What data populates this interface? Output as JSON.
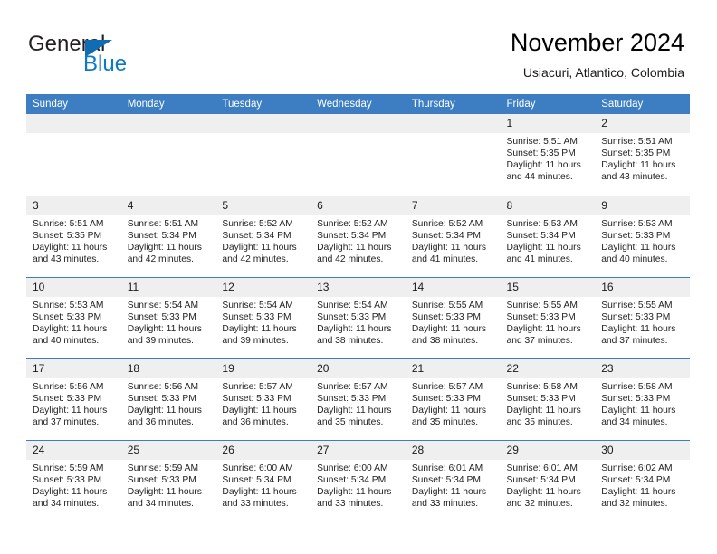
{
  "brand": {
    "name_part1": "General",
    "name_part2": "Blue",
    "icon": "triangle-logo-icon"
  },
  "header": {
    "title": "November 2024",
    "subtitle": "Usiacuri, Atlantico, Colombia"
  },
  "colors": {
    "header_blue": "#3c7ec1",
    "brand_blue": "#0f7ac4",
    "daynum_band": "#efefef",
    "text": "#222222"
  },
  "weekday_headers": [
    "Sunday",
    "Monday",
    "Tuesday",
    "Wednesday",
    "Thursday",
    "Friday",
    "Saturday"
  ],
  "weeks": [
    [
      {
        "day": "",
        "blank": true,
        "sunrise": "",
        "sunset": "",
        "daylight_line1": "",
        "daylight_line2": ""
      },
      {
        "day": "",
        "blank": true,
        "sunrise": "",
        "sunset": "",
        "daylight_line1": "",
        "daylight_line2": ""
      },
      {
        "day": "",
        "blank": true,
        "sunrise": "",
        "sunset": "",
        "daylight_line1": "",
        "daylight_line2": ""
      },
      {
        "day": "",
        "blank": true,
        "sunrise": "",
        "sunset": "",
        "daylight_line1": "",
        "daylight_line2": ""
      },
      {
        "day": "",
        "blank": true,
        "sunrise": "",
        "sunset": "",
        "daylight_line1": "",
        "daylight_line2": ""
      },
      {
        "day": "1",
        "sunrise": "Sunrise: 5:51 AM",
        "sunset": "Sunset: 5:35 PM",
        "daylight_line1": "Daylight: 11 hours",
        "daylight_line2": "and 44 minutes."
      },
      {
        "day": "2",
        "sunrise": "Sunrise: 5:51 AM",
        "sunset": "Sunset: 5:35 PM",
        "daylight_line1": "Daylight: 11 hours",
        "daylight_line2": "and 43 minutes."
      }
    ],
    [
      {
        "day": "3",
        "sunrise": "Sunrise: 5:51 AM",
        "sunset": "Sunset: 5:35 PM",
        "daylight_line1": "Daylight: 11 hours",
        "daylight_line2": "and 43 minutes."
      },
      {
        "day": "4",
        "sunrise": "Sunrise: 5:51 AM",
        "sunset": "Sunset: 5:34 PM",
        "daylight_line1": "Daylight: 11 hours",
        "daylight_line2": "and 42 minutes."
      },
      {
        "day": "5",
        "sunrise": "Sunrise: 5:52 AM",
        "sunset": "Sunset: 5:34 PM",
        "daylight_line1": "Daylight: 11 hours",
        "daylight_line2": "and 42 minutes."
      },
      {
        "day": "6",
        "sunrise": "Sunrise: 5:52 AM",
        "sunset": "Sunset: 5:34 PM",
        "daylight_line1": "Daylight: 11 hours",
        "daylight_line2": "and 42 minutes."
      },
      {
        "day": "7",
        "sunrise": "Sunrise: 5:52 AM",
        "sunset": "Sunset: 5:34 PM",
        "daylight_line1": "Daylight: 11 hours",
        "daylight_line2": "and 41 minutes."
      },
      {
        "day": "8",
        "sunrise": "Sunrise: 5:53 AM",
        "sunset": "Sunset: 5:34 PM",
        "daylight_line1": "Daylight: 11 hours",
        "daylight_line2": "and 41 minutes."
      },
      {
        "day": "9",
        "sunrise": "Sunrise: 5:53 AM",
        "sunset": "Sunset: 5:33 PM",
        "daylight_line1": "Daylight: 11 hours",
        "daylight_line2": "and 40 minutes."
      }
    ],
    [
      {
        "day": "10",
        "sunrise": "Sunrise: 5:53 AM",
        "sunset": "Sunset: 5:33 PM",
        "daylight_line1": "Daylight: 11 hours",
        "daylight_line2": "and 40 minutes."
      },
      {
        "day": "11",
        "sunrise": "Sunrise: 5:54 AM",
        "sunset": "Sunset: 5:33 PM",
        "daylight_line1": "Daylight: 11 hours",
        "daylight_line2": "and 39 minutes."
      },
      {
        "day": "12",
        "sunrise": "Sunrise: 5:54 AM",
        "sunset": "Sunset: 5:33 PM",
        "daylight_line1": "Daylight: 11 hours",
        "daylight_line2": "and 39 minutes."
      },
      {
        "day": "13",
        "sunrise": "Sunrise: 5:54 AM",
        "sunset": "Sunset: 5:33 PM",
        "daylight_line1": "Daylight: 11 hours",
        "daylight_line2": "and 38 minutes."
      },
      {
        "day": "14",
        "sunrise": "Sunrise: 5:55 AM",
        "sunset": "Sunset: 5:33 PM",
        "daylight_line1": "Daylight: 11 hours",
        "daylight_line2": "and 38 minutes."
      },
      {
        "day": "15",
        "sunrise": "Sunrise: 5:55 AM",
        "sunset": "Sunset: 5:33 PM",
        "daylight_line1": "Daylight: 11 hours",
        "daylight_line2": "and 37 minutes."
      },
      {
        "day": "16",
        "sunrise": "Sunrise: 5:55 AM",
        "sunset": "Sunset: 5:33 PM",
        "daylight_line1": "Daylight: 11 hours",
        "daylight_line2": "and 37 minutes."
      }
    ],
    [
      {
        "day": "17",
        "sunrise": "Sunrise: 5:56 AM",
        "sunset": "Sunset: 5:33 PM",
        "daylight_line1": "Daylight: 11 hours",
        "daylight_line2": "and 37 minutes."
      },
      {
        "day": "18",
        "sunrise": "Sunrise: 5:56 AM",
        "sunset": "Sunset: 5:33 PM",
        "daylight_line1": "Daylight: 11 hours",
        "daylight_line2": "and 36 minutes."
      },
      {
        "day": "19",
        "sunrise": "Sunrise: 5:57 AM",
        "sunset": "Sunset: 5:33 PM",
        "daylight_line1": "Daylight: 11 hours",
        "daylight_line2": "and 36 minutes."
      },
      {
        "day": "20",
        "sunrise": "Sunrise: 5:57 AM",
        "sunset": "Sunset: 5:33 PM",
        "daylight_line1": "Daylight: 11 hours",
        "daylight_line2": "and 35 minutes."
      },
      {
        "day": "21",
        "sunrise": "Sunrise: 5:57 AM",
        "sunset": "Sunset: 5:33 PM",
        "daylight_line1": "Daylight: 11 hours",
        "daylight_line2": "and 35 minutes."
      },
      {
        "day": "22",
        "sunrise": "Sunrise: 5:58 AM",
        "sunset": "Sunset: 5:33 PM",
        "daylight_line1": "Daylight: 11 hours",
        "daylight_line2": "and 35 minutes."
      },
      {
        "day": "23",
        "sunrise": "Sunrise: 5:58 AM",
        "sunset": "Sunset: 5:33 PM",
        "daylight_line1": "Daylight: 11 hours",
        "daylight_line2": "and 34 minutes."
      }
    ],
    [
      {
        "day": "24",
        "sunrise": "Sunrise: 5:59 AM",
        "sunset": "Sunset: 5:33 PM",
        "daylight_line1": "Daylight: 11 hours",
        "daylight_line2": "and 34 minutes."
      },
      {
        "day": "25",
        "sunrise": "Sunrise: 5:59 AM",
        "sunset": "Sunset: 5:33 PM",
        "daylight_line1": "Daylight: 11 hours",
        "daylight_line2": "and 34 minutes."
      },
      {
        "day": "26",
        "sunrise": "Sunrise: 6:00 AM",
        "sunset": "Sunset: 5:34 PM",
        "daylight_line1": "Daylight: 11 hours",
        "daylight_line2": "and 33 minutes."
      },
      {
        "day": "27",
        "sunrise": "Sunrise: 6:00 AM",
        "sunset": "Sunset: 5:34 PM",
        "daylight_line1": "Daylight: 11 hours",
        "daylight_line2": "and 33 minutes."
      },
      {
        "day": "28",
        "sunrise": "Sunrise: 6:01 AM",
        "sunset": "Sunset: 5:34 PM",
        "daylight_line1": "Daylight: 11 hours",
        "daylight_line2": "and 33 minutes."
      },
      {
        "day": "29",
        "sunrise": "Sunrise: 6:01 AM",
        "sunset": "Sunset: 5:34 PM",
        "daylight_line1": "Daylight: 11 hours",
        "daylight_line2": "and 32 minutes."
      },
      {
        "day": "30",
        "sunrise": "Sunrise: 6:02 AM",
        "sunset": "Sunset: 5:34 PM",
        "daylight_line1": "Daylight: 11 hours",
        "daylight_line2": "and 32 minutes."
      }
    ]
  ]
}
